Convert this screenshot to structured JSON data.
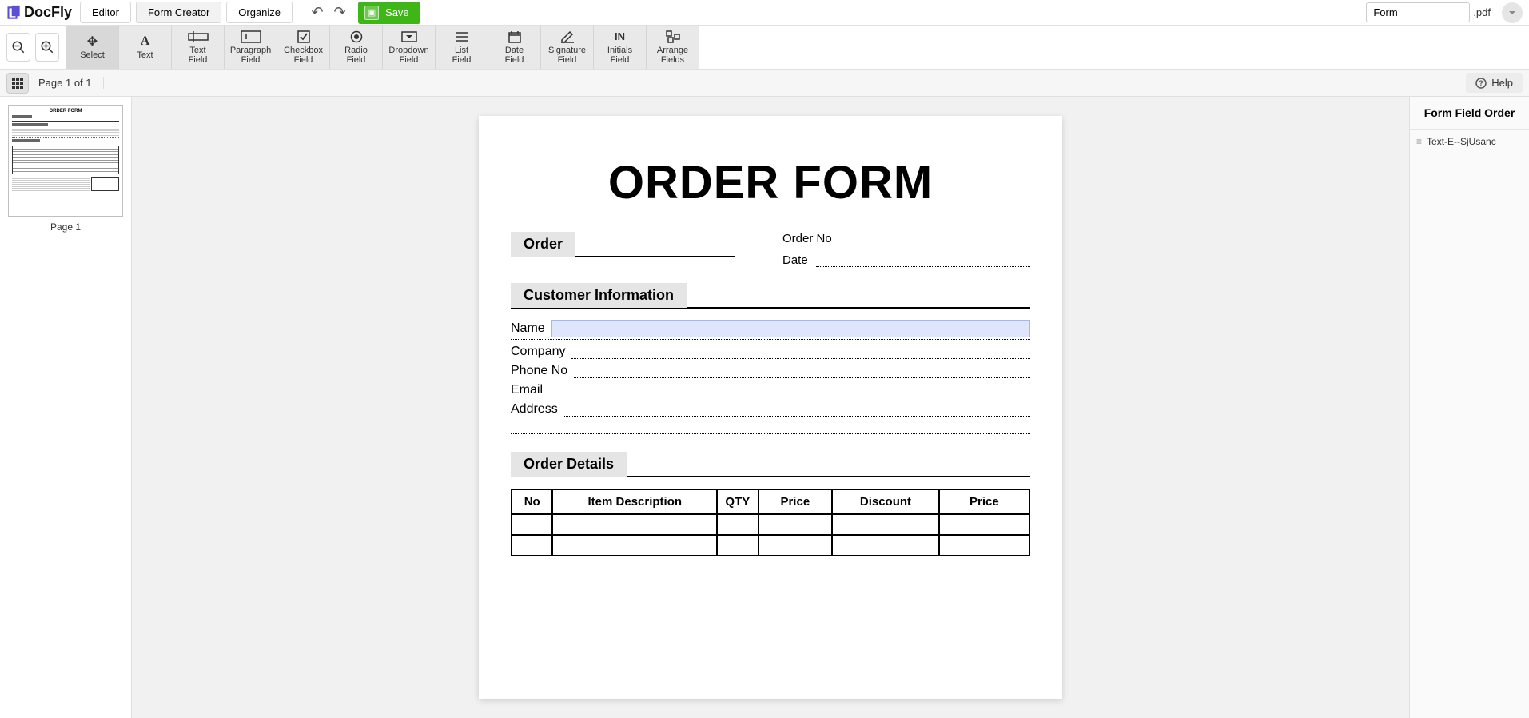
{
  "brand": "DocFly",
  "tabs": {
    "editor": "Editor",
    "form_creator": "Form Creator",
    "organize": "Organize"
  },
  "save_label": "Save",
  "filename": "Form",
  "file_ext": ".pdf",
  "tools": {
    "select": "Select",
    "text": "Text",
    "text_field": "Text\nField",
    "paragraph_field": "Paragraph\nField",
    "checkbox_field": "Checkbox\nField",
    "radio_field": "Radio\nField",
    "dropdown_field": "Dropdown\nField",
    "list_field": "List\nField",
    "date_field": "Date\nField",
    "signature_field": "Signature\nField",
    "initials_field": "Initials\nField",
    "arrange_fields": "Arrange\nFields"
  },
  "page_info": "Page 1 of 1",
  "help_label": "Help",
  "thumb_caption": "Page 1",
  "thumb_title": "ORDER FORM",
  "right_panel": {
    "title": "Form Field Order",
    "items": [
      "Text-E--SjUsanc"
    ]
  },
  "doc": {
    "title": "ORDER FORM",
    "sections": {
      "order": "Order",
      "customer_info": "Customer Information",
      "order_details": "Order Details"
    },
    "meta": {
      "order_no": "Order No",
      "date": "Date"
    },
    "fields": {
      "name": "Name",
      "company": "Company",
      "phone": "Phone No",
      "email": "Email",
      "address": "Address"
    },
    "table_headers": [
      "No",
      "Item Description",
      "QTY",
      "Price",
      "Discount",
      "Price"
    ]
  }
}
